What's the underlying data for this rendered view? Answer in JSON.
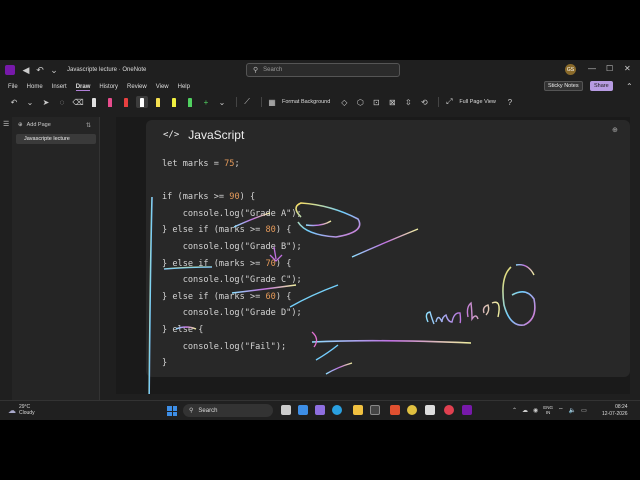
{
  "titlebar": {
    "doc_title": "Javascripte lecture · OneNote",
    "search_placeholder": "Search",
    "avatar_initials": "GS"
  },
  "menu": {
    "items": [
      "File",
      "Home",
      "Insert",
      "Draw",
      "History",
      "Review",
      "View",
      "Help"
    ],
    "active": "Draw",
    "sticky_notes": "Sticky Notes",
    "share": "Share"
  },
  "toolbar": {
    "format_background": "Format Background",
    "full_page_view": "Full Page View",
    "pen_colors": [
      "#e0e0e0",
      "#e74c8c",
      "#e84040",
      "#ffffff",
      "#f5e050",
      "#f0f040",
      "#50d060"
    ]
  },
  "pages": {
    "add_page": "Add Page",
    "items": [
      "Javascripte lecture"
    ]
  },
  "note": {
    "lang_label": "JavaScript",
    "code_lines": [
      "let marks = 75;",
      "",
      "if (marks >= 90) {",
      "    console.log(\"Grade A\");",
      "} else if (marks >= 80) {",
      "    console.log(\"Grade B\");",
      "} else if (marks >= 70) {",
      "    console.log(\"Grade C\");",
      "} else if (marks >= 60) {",
      "    console.log(\"Grade D\");",
      "} else {",
      "    console.log(\"Fail\");",
      "}"
    ]
  },
  "taskbar": {
    "weather_temp": "29°C",
    "weather_desc": "Cloudy",
    "search_label": "Search",
    "lang_line1": "ENG",
    "lang_line2": "IN",
    "time": "08:24",
    "date": "12-07-2026"
  }
}
